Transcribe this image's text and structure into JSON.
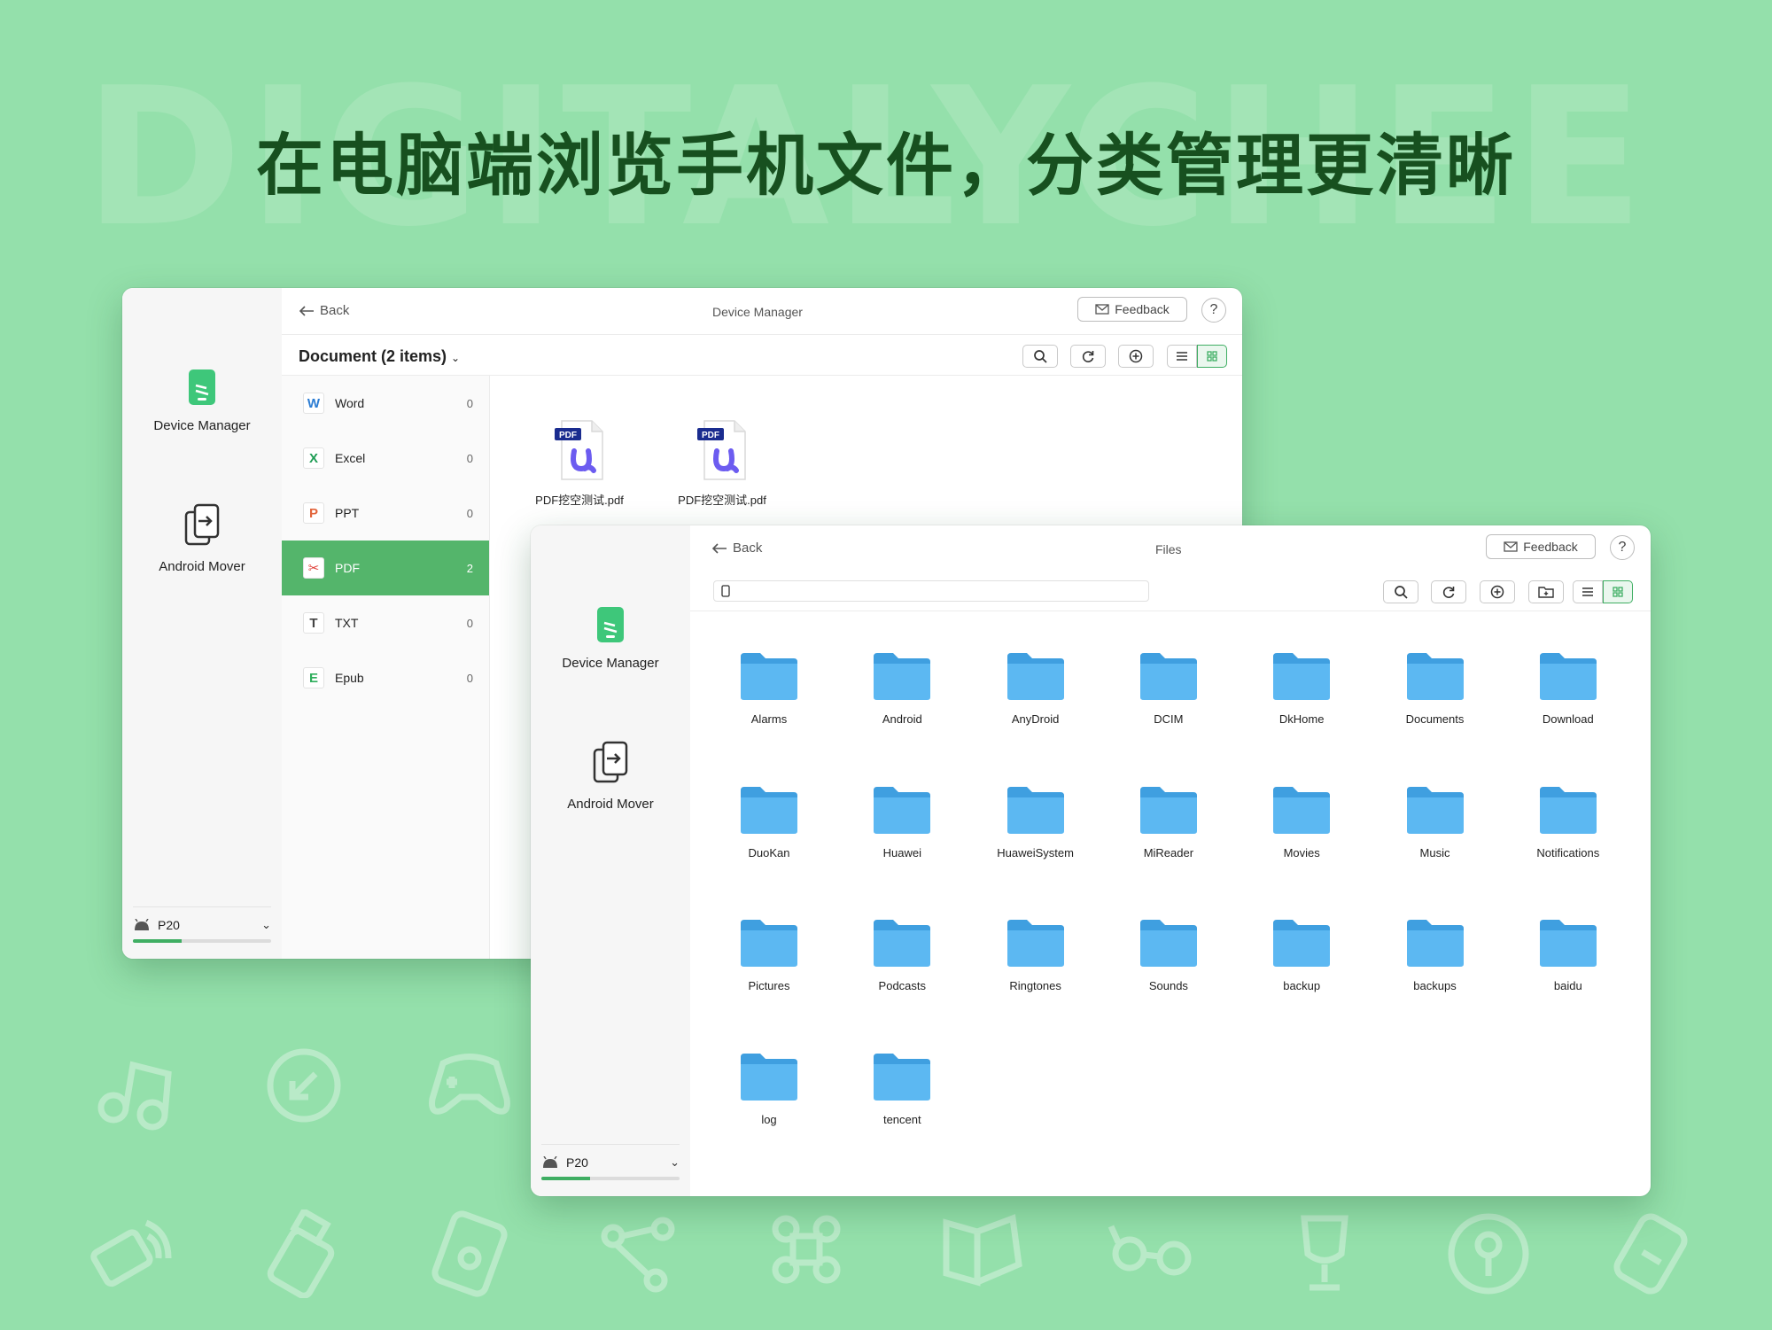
{
  "background_word": "DIGITALYCHEE",
  "headline": "在电脑端浏览手机文件，分类管理更清晰",
  "colors": {
    "background": "#94e0ab",
    "accent": "#54b56b",
    "headline": "#17501f",
    "folder": "#5cb8f2"
  },
  "win1": {
    "back_label": "Back",
    "title": "Device Manager",
    "feedback_label": "Feedback",
    "help_label": "?",
    "sidebar": [
      {
        "label": "Device Manager",
        "icon": "phone-icon"
      },
      {
        "label": "Android Mover",
        "icon": "transfer-icon"
      }
    ],
    "device": {
      "name": "P20",
      "storage_used_fraction": 0.35
    },
    "section_title": "Document (2 items)",
    "section_chevron": "⌄",
    "categories": [
      {
        "label": "Word",
        "count": "0",
        "icon_letter": "W",
        "color": "#2b7cd3"
      },
      {
        "label": "Excel",
        "count": "0",
        "icon_letter": "X",
        "color": "#1f9d55"
      },
      {
        "label": "PPT",
        "count": "0",
        "icon_letter": "P",
        "color": "#e2643b"
      },
      {
        "label": "PDF",
        "count": "2",
        "icon_letter": "✂",
        "color": "#e0413a",
        "active": true
      },
      {
        "label": "TXT",
        "count": "0",
        "icon_letter": "T",
        "color": "#444444"
      },
      {
        "label": "Epub",
        "count": "0",
        "icon_letter": "E",
        "color": "#2fae5c"
      }
    ],
    "files": [
      {
        "name": "PDF挖空测试.pdf",
        "badge": "PDF"
      },
      {
        "name": "PDF挖空测试.pdf",
        "badge": "PDF"
      }
    ]
  },
  "win2": {
    "back_label": "Back",
    "title": "Files",
    "feedback_label": "Feedback",
    "help_label": "?",
    "sidebar": [
      {
        "label": "Device Manager",
        "icon": "phone-icon"
      },
      {
        "label": "Android Mover",
        "icon": "transfer-icon"
      }
    ],
    "device": {
      "name": "P20",
      "storage_used_fraction": 0.35
    },
    "path_placeholder": "",
    "folders": [
      "Alarms",
      "Android",
      "AnyDroid",
      "DCIM",
      "DkHome",
      "Documents",
      "Download",
      "DuoKan",
      "Huawei",
      "HuaweiSystem",
      "MiReader",
      "Movies",
      "Music",
      "Notifications",
      "Pictures",
      "Podcasts",
      "Ringtones",
      "Sounds",
      "backup",
      "backups",
      "baidu",
      "log",
      "tencent"
    ]
  }
}
